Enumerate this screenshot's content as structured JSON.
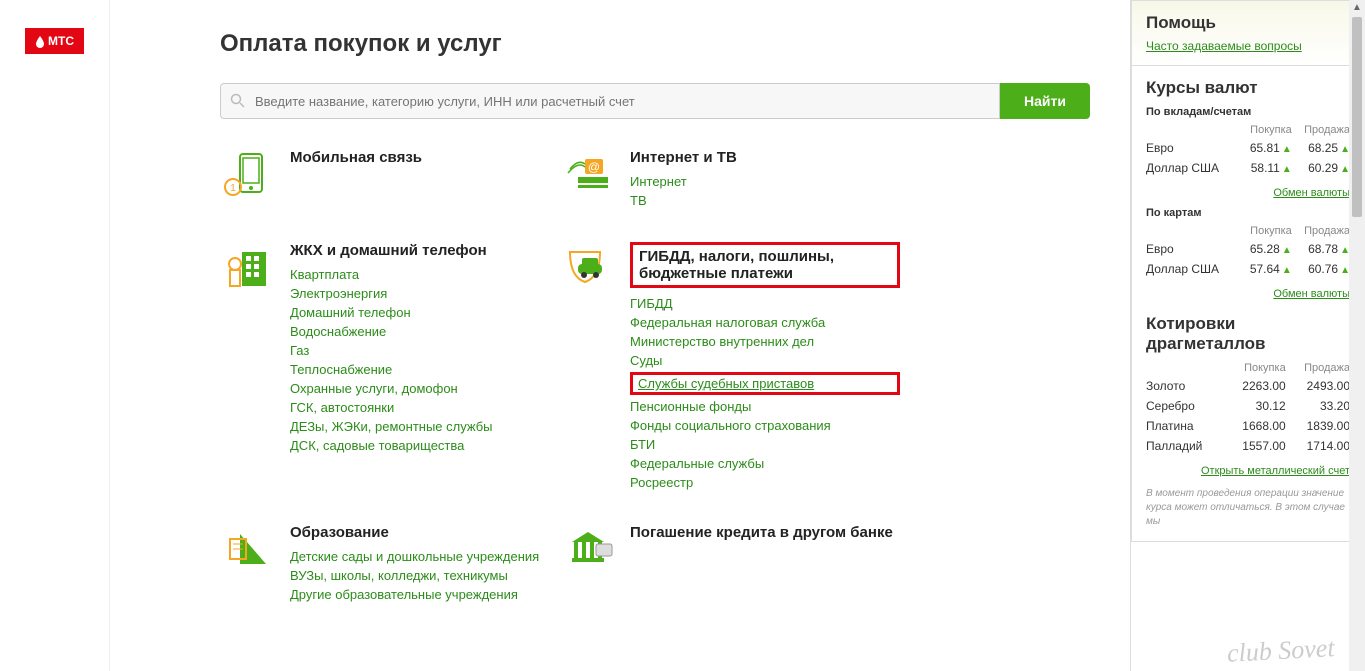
{
  "logo": "МТС",
  "title": "Оплата покупок и услуг",
  "search": {
    "placeholder": "Введите название, категорию услуги, ИНН или расчетный счет",
    "button": "Найти"
  },
  "cats": {
    "mobile": {
      "title": "Мобильная связь"
    },
    "internet": {
      "title": "Интернет и ТВ",
      "links": [
        "Интернет",
        "ТВ"
      ]
    },
    "zhkh": {
      "title": "ЖКХ и домашний телефон",
      "links": [
        "Квартплата",
        "Электроэнергия",
        "Домашний телефон",
        "Водоснабжение",
        "Газ",
        "Теплоснабжение",
        "Охранные услуги, домофон",
        "ГСК, автостоянки",
        "ДЕЗы, ЖЭКи, ремонтные службы",
        "ДСК, садовые товарищества"
      ]
    },
    "gibdd": {
      "title": "ГИБДД, налоги, пошлины, бюджетные платежи",
      "links": [
        "ГИБДД",
        "Федеральная налоговая служба",
        "Министерство внутренних дел",
        "Суды",
        "Службы судебных приставов",
        "Пенсионные фонды",
        "Фонды социального страхования",
        "БТИ",
        "Федеральные службы",
        "Росреестр"
      ]
    },
    "edu": {
      "title": "Образование",
      "links": [
        "Детские сады и дошкольные учреждения",
        "ВУЗы, школы, колледжи, техникумы",
        "Другие образовательные учреждения"
      ]
    },
    "credit": {
      "title": "Погашение кредита в другом банке"
    }
  },
  "help": {
    "title": "Помощь",
    "faq": "Часто задаваемые вопросы"
  },
  "rates": {
    "title": "Курсы валют",
    "sub1": "По вкладам/счетам",
    "th_buy": "Покупка",
    "th_sell": "Продажа",
    "deposits": [
      {
        "name": "Евро",
        "buy": "65.81",
        "sell": "68.25"
      },
      {
        "name": "Доллар США",
        "buy": "58.11",
        "sell": "60.29"
      }
    ],
    "exch": "Обмен валюты",
    "sub2": "По картам",
    "cards": [
      {
        "name": "Евро",
        "buy": "65.28",
        "sell": "68.78"
      },
      {
        "name": "Доллар США",
        "buy": "57.64",
        "sell": "60.76"
      }
    ]
  },
  "metals": {
    "title": "Котировки драгметаллов",
    "rows": [
      {
        "name": "Золото",
        "buy": "2263.00",
        "sell": "2493.00"
      },
      {
        "name": "Серебро",
        "buy": "30.12",
        "sell": "33.20"
      },
      {
        "name": "Платина",
        "buy": "1668.00",
        "sell": "1839.00"
      },
      {
        "name": "Палладий",
        "buy": "1557.00",
        "sell": "1714.00"
      }
    ],
    "open": "Открыть металлический счет"
  },
  "note": "В момент проведения операции значение курса может отличаться. В этом случае мы",
  "watermark": "club Sovet"
}
